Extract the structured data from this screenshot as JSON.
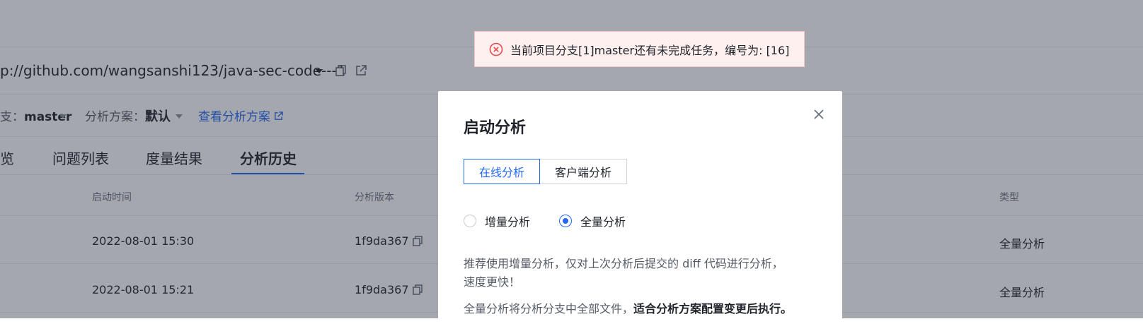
{
  "header": {
    "repo_url": "p://github.com/wangsanshi123/java-sec-code---1",
    "branch_label": "支：",
    "branch_value": "master",
    "scheme_label": "分析方案：",
    "scheme_value": "默认",
    "view_scheme_link": "查看分析方案"
  },
  "tabs": [
    {
      "label": "览"
    },
    {
      "label": "问题列表"
    },
    {
      "label": "度量结果"
    },
    {
      "label": "分析历史"
    }
  ],
  "table": {
    "columns": [
      "启动时间",
      "分析版本",
      "类型"
    ],
    "rows": [
      {
        "start_time": "2022-08-01 15:30",
        "version": "1f9da367",
        "type": "全量分析"
      },
      {
        "start_time": "2022-08-01 15:21",
        "version": "1f9da367",
        "type": "全量分析"
      }
    ]
  },
  "toast": {
    "message": "当前项目分支[1]master还有未完成任务，编号为: [16]",
    "icon": "error-circle-icon",
    "color": "#e5484d"
  },
  "modal": {
    "title": "启动分析",
    "seg_options": [
      "在线分析",
      "客户端分析"
    ],
    "radio_options": [
      "增量分析",
      "全量分析"
    ],
    "selected_radio": "全量分析",
    "desc_line1": "推荐使用增量分析，仅对上次分析后提交的 diff 代码进行分析，",
    "desc_line2": "速度更快！",
    "desc_line3_prefix": "全量分析将分析分支中全部文件，",
    "desc_line3_bold": "适合分析方案配置变更后执行。"
  },
  "colors": {
    "accent": "#2468f2",
    "error": "#e5484d"
  }
}
